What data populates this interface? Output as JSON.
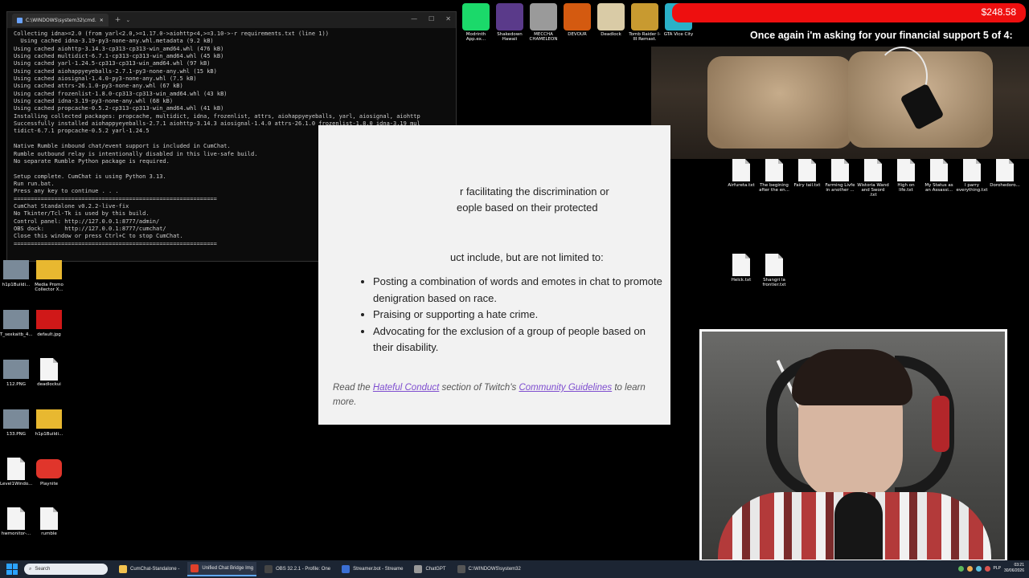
{
  "terminal": {
    "title": "C:\\WINDOWS\\system32\\cmd.",
    "lines": [
      "Collecting idna>=2.0 (from yarl<2.0,>=1.17.0->aiohttp<4,>=3.10->-r requirements.txt (line 1))",
      "  Using cached idna-3.19-py3-none-any.whl.metadata (9.2 kB)",
      "Using cached aiohttp-3.14.3-cp313-cp313-win_amd64.whl (476 kB)",
      "Using cached multidict-6.7.1-cp313-cp313-win_amd64.whl (45 kB)",
      "Using cached yarl-1.24.5-cp313-cp313-win_amd64.whl (97 kB)",
      "Using cached aiohappyeyeballs-2.7.1-py3-none-any.whl (15 kB)",
      "Using cached aiosignal-1.4.0-py3-none-any.whl (7.5 kB)",
      "Using cached attrs-26.1.0-py3-none-any.whl (67 kB)",
      "Using cached frozenlist-1.8.0-cp313-cp313-win_amd64.whl (43 kB)",
      "Using cached idna-3.19-py3-none-any.whl (68 kB)",
      "Using cached propcache-0.5.2-cp313-cp313-win_amd64.whl (41 kB)",
      "Installing collected packages: propcache, multidict, idna, frozenlist, attrs, aiohappyeyeballs, yarl, aiosignal, aiohttp",
      "Successfully installed aiohappyeyeballs-2.7.1 aiohttp-3.14.3 aiosignal-1.4.0 attrs-26.1.0 frozenlist-1.8.0 idna-3.19 mul",
      "tidict-6.7.1 propcache-0.5.2 yarl-1.24.5",
      "",
      "Native Rumble inbound chat/event support is included in CumChat.",
      "Rumble outbound relay is intentionally disabled in this live-safe build.",
      "No separate Rumble Python package is required.",
      "",
      "Setup complete. CumChat is using Python 3.13.",
      "Run run.bat.",
      "Press any key to continue . . .",
      "============================================================",
      "CumChat Standalone v0.2.2-live-fix",
      "No Tkinter/Tcl-Tk is used by this build.",
      "Control panel: http://127.0.0.1:8777/admin/",
      "OBS dock:      http://127.0.0.1:8777/cumchat/",
      "Close this window or press Ctrl+C to stop CumChat.",
      "============================================================"
    ]
  },
  "top_icons": [
    {
      "label": "Modrinth App.ex...",
      "color": "#1bd96a"
    },
    {
      "label": "Shakedown Hawaii",
      "color": "#5a3a8a"
    },
    {
      "label": "MECCHA CHAMELEON",
      "color": "#9a9a9a"
    },
    {
      "label": "DEVOUR",
      "color": "#d45a10"
    },
    {
      "label": "Deadlock",
      "color": "#d9cba6"
    },
    {
      "label": "Tomb Raider I-III Remast.",
      "color": "#c89a30"
    },
    {
      "label": "GTA Vice City",
      "color": "#2ab0c8"
    }
  ],
  "donation": {
    "amount": "$248.58",
    "bar_color": "#ee0f0f"
  },
  "ask_text": "Once again i'm asking for your financial support 5 of 4:",
  "card": {
    "line1": "r facilitating the discrimination or",
    "line2": "eople based on their protected",
    "intro": "uct include, but are not limited to:",
    "bullets": [
      "Posting a combination of words and emotes in chat to promote denigration based on race.",
      "Praising or supporting a hate crime.",
      "Advocating for the exclusion of a group of people based on their disability."
    ],
    "foot_pre": "Read the ",
    "link1": "Hateful Conduct",
    "foot_mid": " section of Twitch's ",
    "link2": "Community Guidelines",
    "foot_post": " to learn more."
  },
  "right_files": [
    "Airfureta.txt",
    "The begining after the en...",
    "Fairy tail.txt",
    "Farming Livfe in another ...",
    "Wistoria Wand and Sword .txt",
    "High on life.txt",
    "My Status as an Assassi...",
    "I parry everything.txt",
    "Dorohedoro..."
  ],
  "right_files2": [
    "Helck.txt",
    "Shangri la frontier.txt"
  ],
  "left_icons": [
    {
      "label": "h1p1Buildi...",
      "kind": "thumb"
    },
    {
      "label": "Media Promo Collector X...",
      "kind": "folder"
    },
    {
      "label": "T_sexkaitb_4...",
      "kind": "thumb"
    },
    {
      "label": "default.jpg",
      "kind": "red"
    },
    {
      "label": "112.PNG",
      "kind": "thumb"
    },
    {
      "label": "deadlockui",
      "kind": "doc"
    },
    {
      "label": "133.PNG",
      "kind": "thumb"
    },
    {
      "label": "h1p1Buildi...",
      "kind": "folder"
    },
    {
      "label": "Level1Windo...",
      "kind": "doc"
    },
    {
      "label": "Playnite",
      "kind": "pad"
    },
    {
      "label": "hwmonitor-...",
      "kind": "doc"
    },
    {
      "label": "rumble",
      "kind": "doc"
    }
  ],
  "taskbar": {
    "search": "Search",
    "items": [
      {
        "label": "CumChat-Standalone -",
        "color": "#f2c14e",
        "active": false
      },
      {
        "label": "Unified Chat Bridge Img",
        "color": "#e0402a",
        "active": true
      },
      {
        "label": "OBS 32.2.1 - Profile: One",
        "color": "#444444",
        "active": false
      },
      {
        "label": "Streamer.bot - Streame",
        "color": "#3b6fd4",
        "active": false
      },
      {
        "label": "ChatGPT",
        "color": "#999999",
        "active": false
      },
      {
        "label": "C:\\WINDOWS\\system32",
        "color": "#555555",
        "active": false
      }
    ],
    "lang": "PLP",
    "time": "03:21",
    "date": "30/06/2026"
  }
}
